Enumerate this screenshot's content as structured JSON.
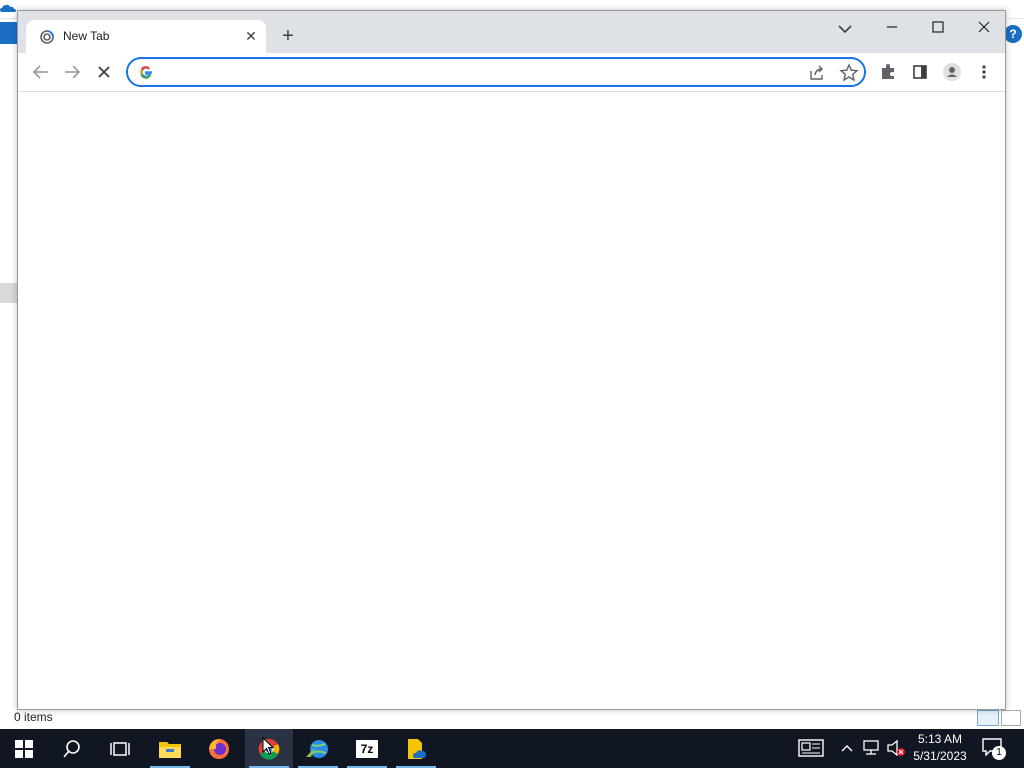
{
  "background_window": {
    "status_text": "0 items",
    "help_label": "?"
  },
  "browser": {
    "tab": {
      "title": "New Tab",
      "close_label": "✕"
    },
    "new_tab_label": "+",
    "omnibox": {
      "value": "",
      "placeholder": ""
    },
    "colors": {
      "accent": "#1a73e8",
      "tabstrip": "#dee1e6"
    }
  },
  "taskbar": {
    "items": [
      {
        "name": "start",
        "icon": "windows-icon"
      },
      {
        "name": "search",
        "icon": "search-icon"
      },
      {
        "name": "task-view",
        "icon": "task-view-icon"
      },
      {
        "name": "file-explorer",
        "icon": "folder-icon"
      },
      {
        "name": "firefox",
        "icon": "firefox-icon"
      },
      {
        "name": "chrome",
        "icon": "chrome-icon"
      },
      {
        "name": "network-app",
        "icon": "globe-icon"
      },
      {
        "name": "7zip",
        "icon": "7zip-icon",
        "label": "7z"
      },
      {
        "name": "documents",
        "icon": "file-icon"
      }
    ],
    "clock": {
      "time": "5:13 AM",
      "date": "5/31/2023"
    },
    "notification_count": "1"
  }
}
